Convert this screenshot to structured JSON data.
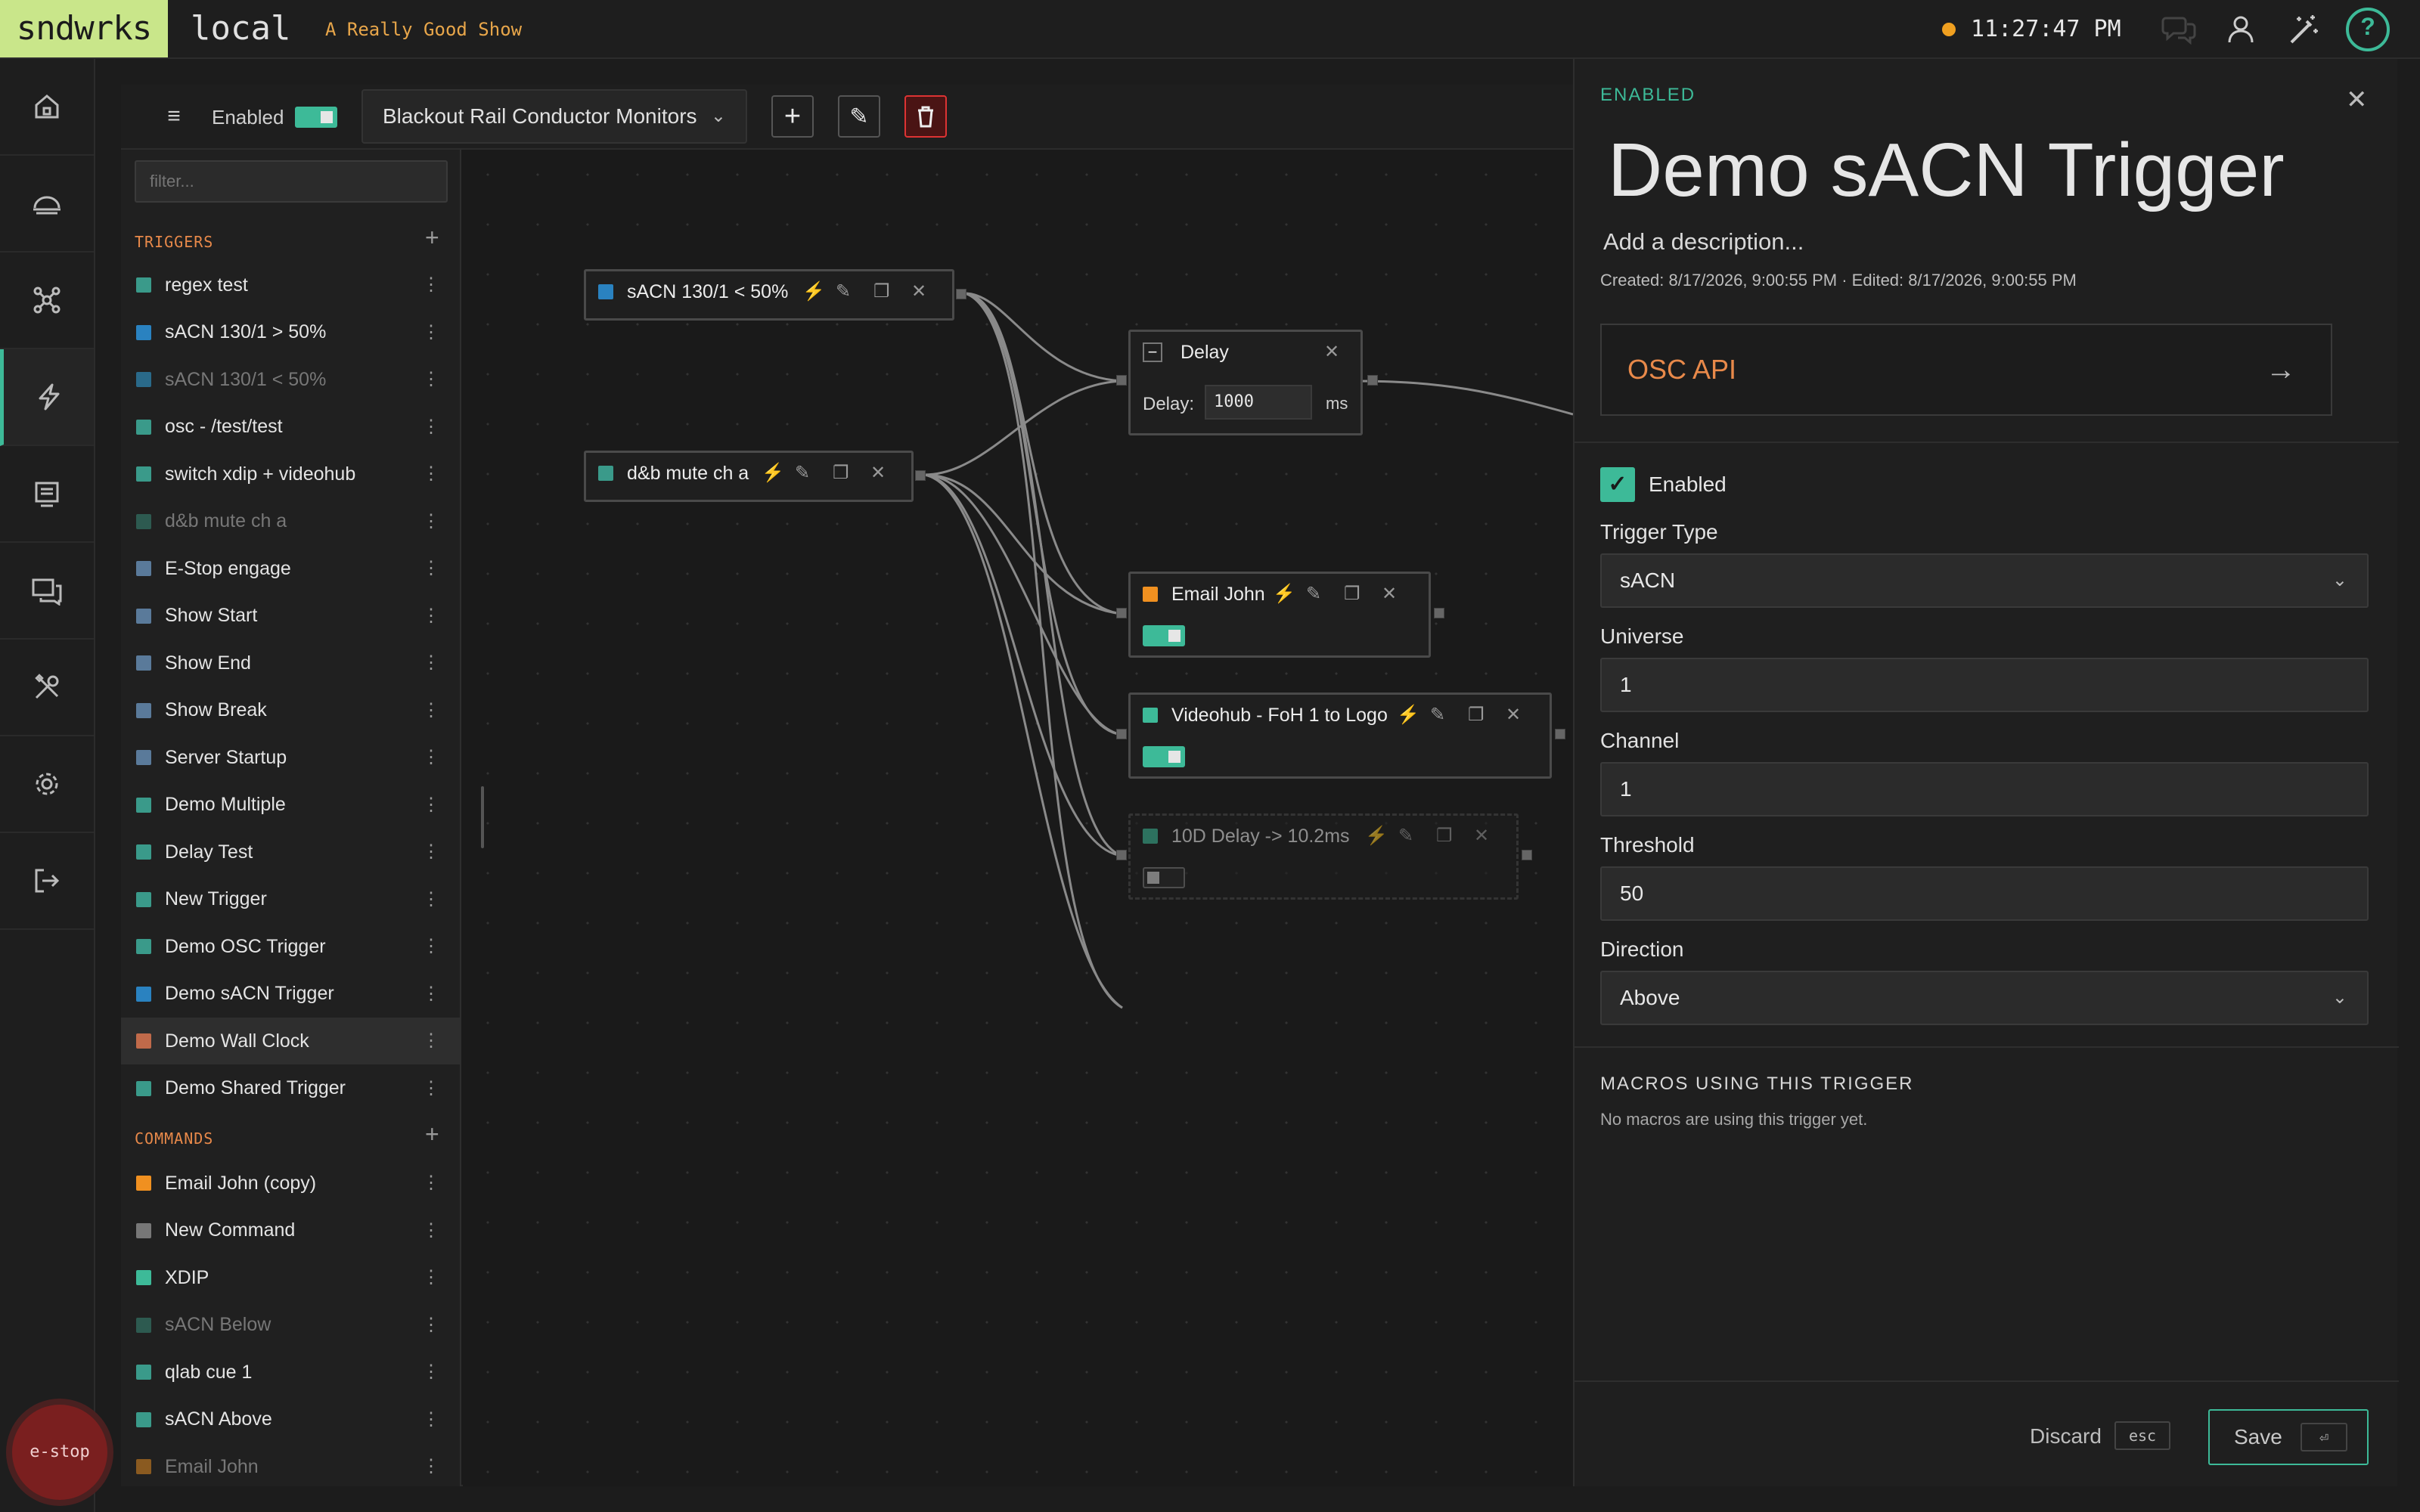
{
  "app": {
    "logo": "sndwrks",
    "env": "local",
    "show_name": "A Really Good Show",
    "clock": "11:27:47 PM",
    "status_color": "#f0a020",
    "accent": "#3dba98"
  },
  "topbar_icons": [
    "chat-icon",
    "user-icon",
    "magic-wand-icon",
    "help-icon"
  ],
  "help_glyph": "?",
  "nav": {
    "items": [
      "home-icon",
      "dashboard-icon",
      "network-icon",
      "trigger-bolt-icon",
      "monitor-icon",
      "messages-icon",
      "tools-icon",
      "settings-icon",
      "logout-icon"
    ],
    "active_index": 3
  },
  "estop_label": "e-stop",
  "toolbar": {
    "menu_glyph": "≡",
    "enabled_label": "Enabled",
    "macro_name": "Blackout Rail Conductor Monitors",
    "add_glyph": "+",
    "edit_glyph": "✎",
    "delete_glyph": "🗑"
  },
  "sidelist": {
    "filter_placeholder": "filter...",
    "triggers_header": "TRIGGERS",
    "commands_header": "COMMANDS",
    "add_glyph": "+",
    "more_glyph": "⋮",
    "triggers": [
      {
        "label": "regex test",
        "color": "#3a9a8a",
        "dim": false
      },
      {
        "label": "sACN 130/1 > 50%",
        "color": "#2a82c0",
        "dim": false
      },
      {
        "label": "sACN 130/1 < 50%",
        "color": "#2a6a8a",
        "dim": true
      },
      {
        "label": "osc - /test/test",
        "color": "#3a9a8a",
        "dim": false
      },
      {
        "label": "switch xdip + videohub",
        "color": "#3a9a8a",
        "dim": false
      },
      {
        "label": "d&b mute ch a",
        "color": "#2d5a50",
        "dim": true
      },
      {
        "label": "E-Stop engage",
        "color": "#5a7a9a",
        "dim": false
      },
      {
        "label": "Show Start",
        "color": "#5a7a9a",
        "dim": false
      },
      {
        "label": "Show End",
        "color": "#5a7a9a",
        "dim": false
      },
      {
        "label": "Show Break",
        "color": "#5a7a9a",
        "dim": false
      },
      {
        "label": "Server Startup",
        "color": "#5a7a9a",
        "dim": false
      },
      {
        "label": "Demo Multiple",
        "color": "#3a9a8a",
        "dim": false
      },
      {
        "label": "Delay Test",
        "color": "#3a9a8a",
        "dim": false
      },
      {
        "label": "New Trigger",
        "color": "#3a9a8a",
        "dim": false
      },
      {
        "label": "Demo OSC Trigger",
        "color": "#3a9a8a",
        "dim": false
      },
      {
        "label": "Demo sACN Trigger",
        "color": "#2a82c0",
        "dim": false
      },
      {
        "label": "Demo Wall Clock",
        "color": "#c06a4a",
        "dim": false
      },
      {
        "label": "Demo Shared Trigger",
        "color": "#3a9a8a",
        "dim": false
      }
    ],
    "selected_index": 16,
    "commands": [
      {
        "label": "Email John (copy)",
        "color": "#f09020",
        "dim": false
      },
      {
        "label": "New Command",
        "color": "#777777",
        "dim": false
      },
      {
        "label": "XDIP",
        "color": "#3dba98",
        "dim": false
      },
      {
        "label": "sACN Below",
        "color": "#2d5a50",
        "dim": true
      },
      {
        "label": "qlab cue 1",
        "color": "#3a9a8a",
        "dim": false
      },
      {
        "label": "sACN Above",
        "color": "#3a9a8a",
        "dim": false
      },
      {
        "label": "Email John",
        "color": "#8a5a20",
        "dim": true
      }
    ]
  },
  "graph": {
    "nodes": {
      "sacn": {
        "label": "sACN 130/1 < 50%",
        "color": "#2a82c0"
      },
      "dnb": {
        "label": "d&b mute ch a",
        "color": "#3a9a8a"
      },
      "delay": {
        "label": "Delay",
        "delay_label": "Delay:",
        "delay_value": "1000",
        "unit": "ms",
        "collapse_glyph": "−"
      },
      "email": {
        "label": "Email John",
        "color": "#f09020",
        "enabled": true
      },
      "videohub": {
        "label": "Videohub - FoH 1 to Logo",
        "color": "#3dba98",
        "enabled": true
      },
      "tendelay": {
        "label": "10D Delay -> 10.2ms",
        "color": "#3dba98",
        "enabled": false
      }
    },
    "bolt_glyph": "⚡",
    "edit_glyph": "✎",
    "copy_glyph": "❐",
    "close_glyph": "✕"
  },
  "panel": {
    "status": "ENABLED",
    "close_glyph": "✕",
    "title": "Demo sACN Trigger",
    "description": "Add a description...",
    "meta": "Created: 8/17/2026, 9:00:55 PM · Edited: 8/17/2026, 9:00:55 PM",
    "linked_card_label": "OSC API",
    "linked_card_arrow": "→",
    "enabled_label": "Enabled",
    "enabled_check": "✓",
    "fields": {
      "trigger_type": {
        "label": "Trigger Type",
        "value": "sACN"
      },
      "universe": {
        "label": "Universe",
        "value": "1"
      },
      "channel": {
        "label": "Channel",
        "value": "1"
      },
      "threshold": {
        "label": "Threshold",
        "value": "50"
      },
      "direction": {
        "label": "Direction",
        "value": "Above"
      }
    },
    "macros_header": "MACROS USING THIS TRIGGER",
    "macros_empty": "No macros are using this trigger yet.",
    "discard_label": "Discard",
    "discard_key": "esc",
    "save_label": "Save",
    "save_key": "⏎"
  }
}
